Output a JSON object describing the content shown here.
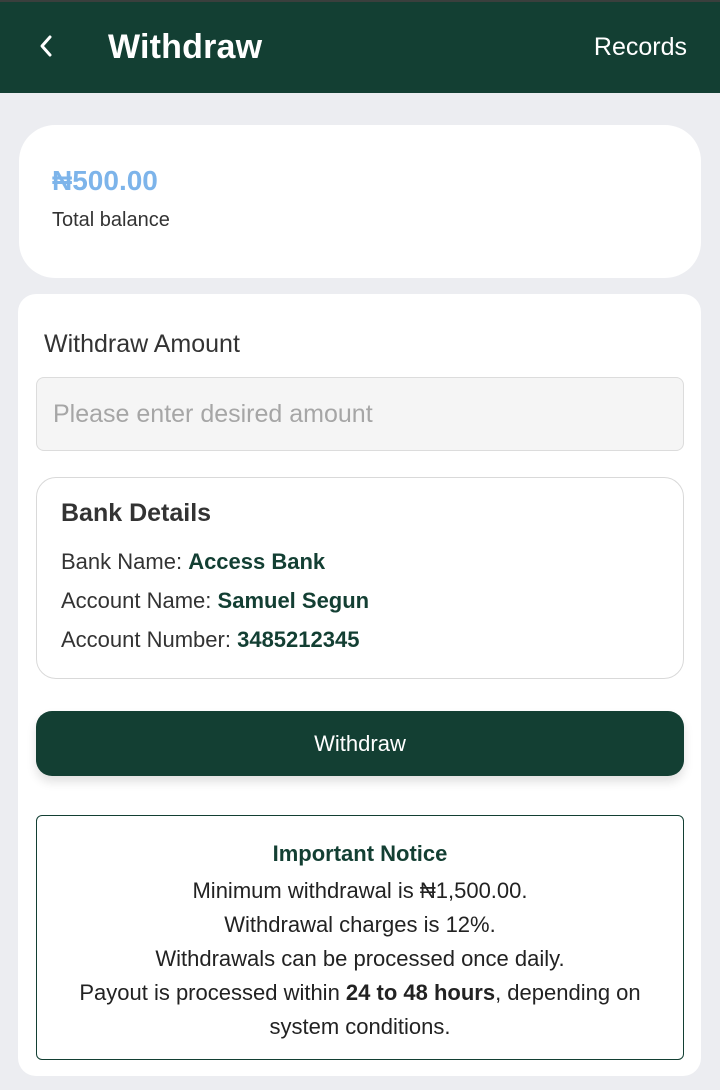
{
  "header": {
    "title": "Withdraw",
    "records_label": "Records",
    "back_icon": "chevron-left-icon",
    "background": "#133f33"
  },
  "balance": {
    "amount": "₦500.00",
    "label": "Total balance",
    "amount_color": "#7db4ea"
  },
  "form": {
    "amount_label": "Withdraw Amount",
    "amount_placeholder": "Please enter desired amount",
    "amount_value": ""
  },
  "bank_details": {
    "title": "Bank Details",
    "bank_name_label": "Bank Name:",
    "bank_name": "Access Bank",
    "account_name_label": "Account Name:",
    "account_name": "Samuel Segun",
    "account_number_label": "Account Number:",
    "account_number": "3485212345"
  },
  "withdraw_button": {
    "label": "Withdraw"
  },
  "notice": {
    "title": "Important Notice",
    "line1": "Minimum withdrawal is ₦1,500.00.",
    "line2": "Withdrawal charges is 12%.",
    "line3": "Withdrawals can be processed once daily.",
    "line4_pre": "Payout is processed within ",
    "line4_bold": "24 to 48 hours",
    "line4_post": ", depending on system conditions."
  },
  "colors": {
    "primary": "#133f33",
    "page_background": "#ecedf1"
  }
}
